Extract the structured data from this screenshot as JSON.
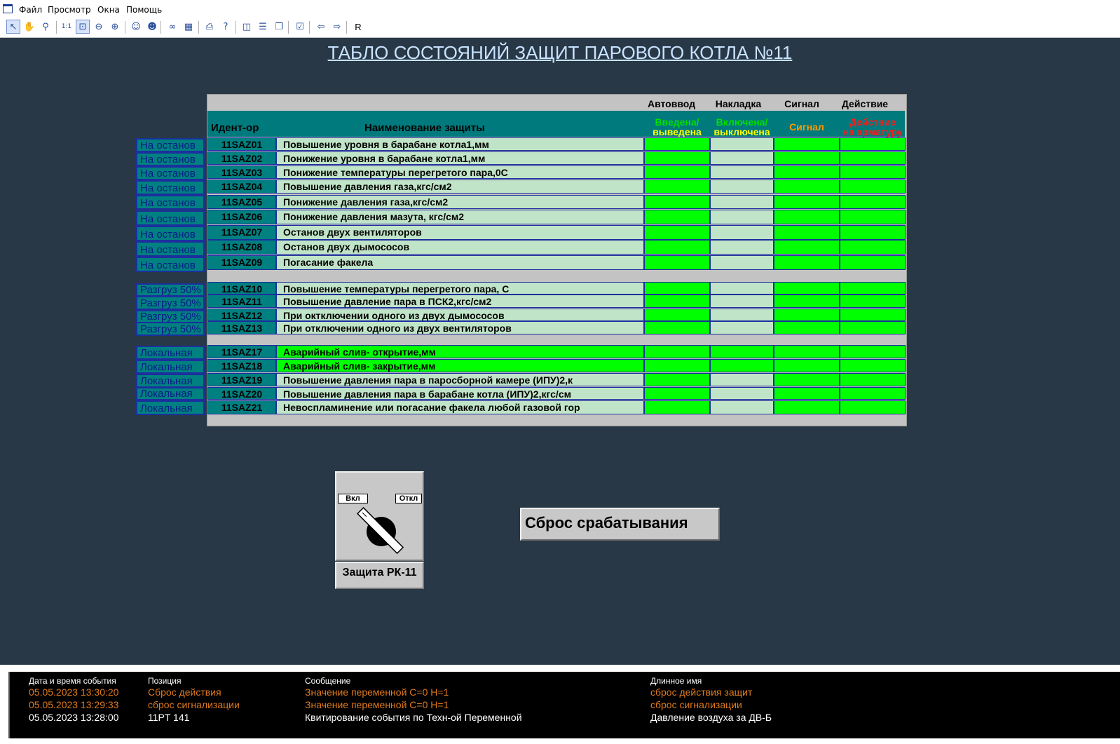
{
  "menu": [
    "Файл",
    "Просмотр",
    "Окна",
    "Помощь"
  ],
  "toolbar": {
    "buttons": [
      {
        "name": "pointer-icon",
        "glyph": "↖",
        "selected": true
      },
      {
        "name": "hand-icon",
        "glyph": "✋"
      },
      {
        "name": "magnifier-icon",
        "glyph": "⚲"
      },
      {
        "name": "actual-size-icon",
        "glyph": "1:1"
      },
      {
        "name": "zoom-fit-icon",
        "glyph": "⊡",
        "selected": true
      },
      {
        "name": "zoom-out-icon",
        "glyph": "⊖"
      },
      {
        "name": "zoom-in-icon",
        "glyph": "⊕"
      },
      {
        "name": "user-find-icon",
        "glyph": "☺"
      },
      {
        "name": "user-icon",
        "glyph": "☻"
      },
      {
        "name": "binoculars-icon",
        "glyph": "∞"
      },
      {
        "name": "table-icon",
        "glyph": "▦"
      },
      {
        "name": "print-icon",
        "glyph": "⎙"
      },
      {
        "name": "help-icon",
        "glyph": "?"
      },
      {
        "name": "panel-icon",
        "glyph": "◫"
      },
      {
        "name": "list-icon",
        "glyph": "☰"
      },
      {
        "name": "windows-icon",
        "glyph": "❐"
      },
      {
        "name": "check-window-icon",
        "glyph": "☑"
      },
      {
        "name": "back-arrow-icon",
        "glyph": "⇦"
      },
      {
        "name": "forward-arrow-icon",
        "glyph": "⇨"
      },
      {
        "name": "r-button",
        "glyph": "R"
      }
    ]
  },
  "title": "ТАБЛО СОСТОЯНИЙ ЗАЩИТ ПАРОВОГО КОТЛА №11",
  "table": {
    "top_headers": [
      "Автоввод",
      "Накладка",
      "Сигнал",
      "Действие"
    ],
    "col_id": "Идент-ор",
    "col_name": "Наименование защиты",
    "status_headers": [
      {
        "l1": "Введена/",
        "l2": "выведена",
        "c1": "#00e000",
        "c2": "#ffff00"
      },
      {
        "l1": "Включена/",
        "l2": "выключена",
        "c1": "#00e000",
        "c2": "#ffff00"
      },
      {
        "l1": "Сигнал",
        "l2": "",
        "c1": "#ff9900",
        "c2": "#ff9900"
      },
      {
        "l1": "Действие",
        "l2": "на арматуру",
        "c1": "#ff1a1a",
        "c2": "#ff1a1a"
      }
    ],
    "rows": [
      {
        "side": "На останов",
        "id": "11SAZ01",
        "name": "Повышение уровня в барабане котла1,мм",
        "st": [
          1,
          0,
          1,
          1
        ]
      },
      {
        "side": "На останов",
        "id": "11SAZ02",
        "name": "Понижение уровня в барабане котла1,мм",
        "st": [
          1,
          0,
          1,
          1
        ]
      },
      {
        "side": "На останов",
        "id": "11SAZ03",
        "name": "Понижение температуры перегретого пара,0С",
        "st": [
          1,
          0,
          1,
          1
        ]
      },
      {
        "side": "На останов",
        "id": "11SAZ04",
        "name": "Повышение давления газа,кгс/см2",
        "st": [
          1,
          0,
          1,
          1
        ]
      },
      {
        "side": "На останов",
        "id": "11SAZ05",
        "name": "Понижение давления газа,кгс/см2",
        "st": [
          1,
          0,
          1,
          1
        ]
      },
      {
        "side": "На останов",
        "id": "11SAZ06",
        "name": "Понижение давления мазута, кгс/см2",
        "st": [
          1,
          0,
          1,
          1
        ]
      },
      {
        "side": "На останов",
        "id": "11SAZ07",
        "name": "Останов двух вентиляторов",
        "st": [
          1,
          0,
          1,
          1
        ]
      },
      {
        "side": "На останов",
        "id": "11SAZ08",
        "name": "Останов двух дымососов",
        "st": [
          1,
          0,
          1,
          1
        ]
      },
      {
        "side": "На останов",
        "id": "11SAZ09",
        "name": "Погасание факела",
        "st": [
          1,
          0,
          1,
          1
        ]
      },
      {
        "side": "Разгруз 50%",
        "id": "11SAZ10",
        "name": "Повышение температуры перегретого пара, С",
        "st": [
          1,
          0,
          1,
          1
        ]
      },
      {
        "side": "Разгруз 50%",
        "id": "11SAZ11",
        "name": "Повышение давление пара в ПСК2,кгс/см2",
        "st": [
          1,
          0,
          1,
          1
        ]
      },
      {
        "side": "Разгруз 50%",
        "id": "11SAZ12",
        "name": "При октключении одного из двух дымососов",
        "st": [
          1,
          0,
          1,
          1
        ]
      },
      {
        "side": "Разгруз 50%",
        "id": "11SAZ13",
        "name": "При отключении одного из двух вентиляторов",
        "st": [
          1,
          0,
          1,
          1
        ]
      },
      {
        "side": "Локальная",
        "id": "11SAZ17",
        "name": "Аварийный слив- открытие,мм",
        "st": [
          1,
          1,
          1,
          1
        ],
        "green": true
      },
      {
        "side": "Локальная",
        "id": "11SAZ18",
        "name": "Аварийный слив- закрытие,мм",
        "st": [
          1,
          1,
          1,
          1
        ],
        "green": true
      },
      {
        "side": "Локальная",
        "id": "11SAZ19",
        "name": "Повышение давления пара в паросборной камере (ИПУ)2,к",
        "st": [
          1,
          0,
          1,
          1
        ]
      },
      {
        "side": "Локальная",
        "id": "11SAZ20",
        "name": "Повышение давления пара в барабане котла (ИПУ)2,кгс/см",
        "st": [
          1,
          0,
          1,
          1
        ]
      },
      {
        "side": "Локальная",
        "id": "11SAZ21",
        "name": "Невоспламинение или погасание факела любой газовой гор",
        "st": [
          1,
          0,
          1,
          1
        ]
      }
    ]
  },
  "colors": {
    "on": "#00ff00",
    "off": "#c0e4c7",
    "teal": "#008080"
  },
  "switch": {
    "on_label": "Вкл",
    "off_label": "Откл",
    "caption": "Защита РК-11"
  },
  "reset_button": "Сброс срабатывания",
  "log": {
    "headers": [
      "Дата и время события",
      "Позиция",
      "Сообщение",
      "Длинное имя"
    ],
    "rows": [
      {
        "time": "05.05.2023 13:30:20",
        "pos": "Сброс действия",
        "msg": "Значение переменной С=0  Н=1",
        "long": "сброс действия защит",
        "color": "#e07a1e"
      },
      {
        "time": "05.05.2023 13:29:33",
        "pos": "сброс сигнализации",
        "msg": "Значение переменной С=0  Н=1",
        "long": "сброс сигнализации",
        "color": "#e07a1e"
      },
      {
        "time": "05.05.2023 13:28:00",
        "pos": "11PT 141",
        "msg": "Квитирование события по Техн-ой Переменной",
        "long": "Давление воздуха за ДВ-Б",
        "color": "#ffffff"
      }
    ]
  }
}
